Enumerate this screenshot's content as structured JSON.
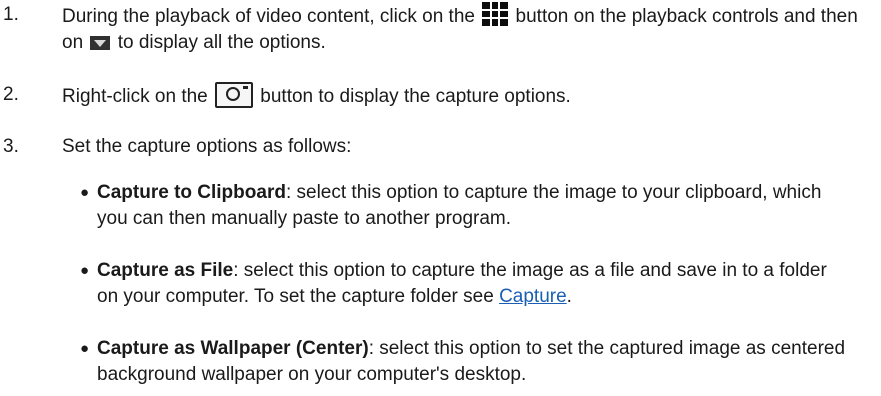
{
  "steps": [
    {
      "number": "1.",
      "text_a": "During the playback of video content, click on the",
      "text_b": "button on the playback controls and then on",
      "text_c": "to display all the options."
    },
    {
      "number": "2.",
      "text_a": "Right-click on the",
      "text_b": "button to display the capture options."
    },
    {
      "number": "3.",
      "text_a": "Set the capture options as follows:"
    }
  ],
  "options": [
    {
      "title": "Capture to Clipboard",
      "description": ": select this option to capture the image to your clipboard, which you can then manually paste to another program."
    },
    {
      "title": "Capture as File",
      "description": ": select this option to capture the image as a file and save in to a folder on your computer. To set the capture folder see ",
      "link": "Capture",
      "after_link": "."
    },
    {
      "title": "Capture as Wallpaper (Center)",
      "description": ": select this option to set the captured image as centered background wallpaper on your computer's desktop."
    }
  ],
  "icons": {
    "grid": "grid-icon",
    "dropdown": "dropdown-icon",
    "camera": "camera-icon"
  },
  "colors": {
    "text": "#1a1a1a",
    "link": "#1a5fb4"
  }
}
